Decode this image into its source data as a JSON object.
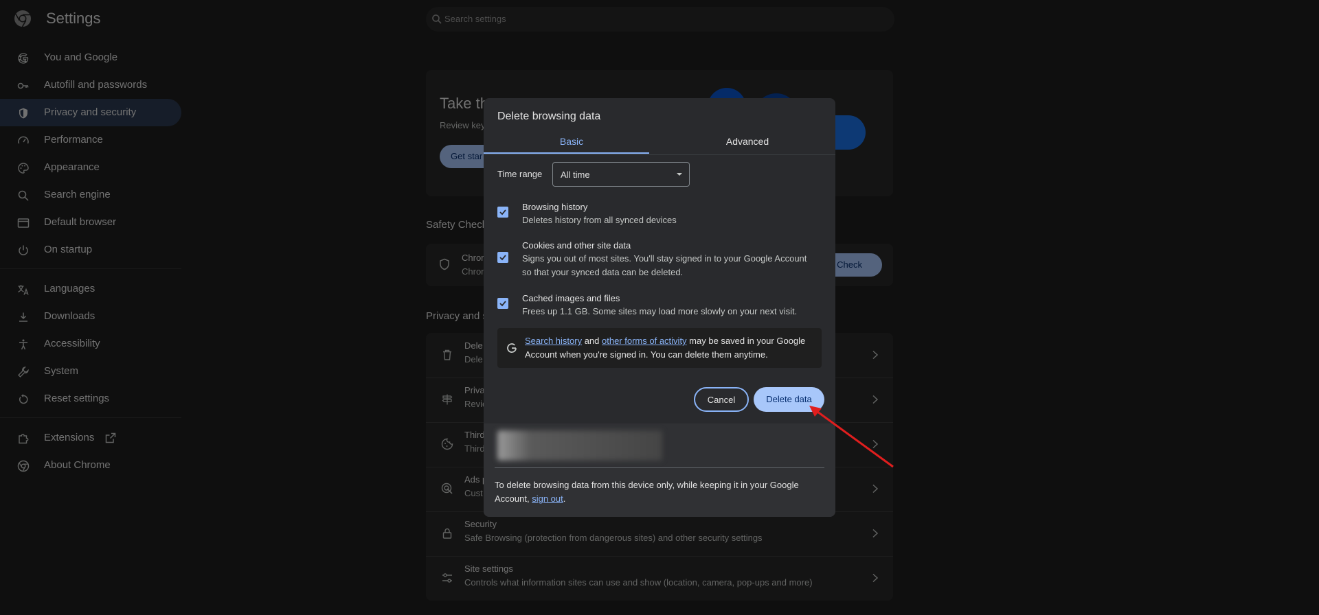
{
  "header": {
    "app_title": "Settings",
    "search_placeholder": "Search settings"
  },
  "sidebar": {
    "items": [
      {
        "label": "You and Google",
        "icon": "google-icon"
      },
      {
        "label": "Autofill and passwords",
        "icon": "key-icon"
      },
      {
        "label": "Privacy and security",
        "icon": "shield-icon",
        "active": true
      },
      {
        "label": "Performance",
        "icon": "speedometer-icon"
      },
      {
        "label": "Appearance",
        "icon": "palette-icon"
      },
      {
        "label": "Search engine",
        "icon": "search-icon"
      },
      {
        "label": "Default browser",
        "icon": "browser-window-icon"
      },
      {
        "label": "On startup",
        "icon": "power-icon"
      },
      {
        "label": "Languages",
        "icon": "translate-icon"
      },
      {
        "label": "Downloads",
        "icon": "download-icon"
      },
      {
        "label": "Accessibility",
        "icon": "accessibility-icon"
      },
      {
        "label": "System",
        "icon": "wrench-icon"
      },
      {
        "label": "Reset settings",
        "icon": "reset-icon"
      },
      {
        "label": "Extensions",
        "icon": "puzzle-icon"
      },
      {
        "label": "About Chrome",
        "icon": "chrome-icon"
      }
    ]
  },
  "main": {
    "hero_title": "Take th",
    "hero_subtitle": "Review key",
    "hero_button": "Get star",
    "safety_check_heading": "Safety Check",
    "safety_check_row_title": "Chrom",
    "safety_check_row_sub": "Chrom",
    "safety_check_button": "y Check",
    "privacy_heading": "Privacy and s",
    "rows": [
      {
        "title": "Dele",
        "sub": "Dele",
        "icon": "trash-icon"
      },
      {
        "title": "Priva",
        "sub": "Revie",
        "icon": "signpost-icon"
      },
      {
        "title": "Third",
        "sub": "Third",
        "icon": "cookie-icon"
      },
      {
        "title": "Ads p",
        "sub": "Cust",
        "icon": "ads-target-icon"
      },
      {
        "title": "Security",
        "sub": "Safe Browsing (protection from dangerous sites) and other security settings",
        "icon": "lock-icon"
      },
      {
        "title": "Site settings",
        "sub": "Controls what information sites can use and show (location, camera, pop-ups and more)",
        "icon": "sliders-icon"
      }
    ]
  },
  "dialog": {
    "title": "Delete browsing data",
    "tabs": {
      "basic": "Basic",
      "advanced": "Advanced"
    },
    "time_range_label": "Time range",
    "time_range_value": "All time",
    "options": [
      {
        "title": "Browsing history",
        "sub": "Deletes history from all synced devices",
        "checked": true
      },
      {
        "title": "Cookies and other site data",
        "sub": "Signs you out of most sites. You'll stay signed in to your Google Account so that your synced data can be deleted.",
        "checked": true
      },
      {
        "title": "Cached images and files",
        "sub": "Frees up 1.1 GB. Some sites may load more slowly on your next visit.",
        "checked": true
      }
    ],
    "google_note": {
      "link1": "Search history",
      "and": " and ",
      "link2": "other forms of activity",
      "rest": " may be saved in your Google Account when you're signed in. You can delete them anytime."
    },
    "cancel_label": "Cancel",
    "delete_label": "Delete data",
    "footer": {
      "text": "To delete browsing data from this device only, while keeping it in your Google Account, ",
      "link": "sign out",
      "end": "."
    }
  },
  "colors": {
    "accent": "#8ab4f8",
    "primary_button": "#a8c7fa",
    "annotation_arrow": "#e01e1e"
  }
}
